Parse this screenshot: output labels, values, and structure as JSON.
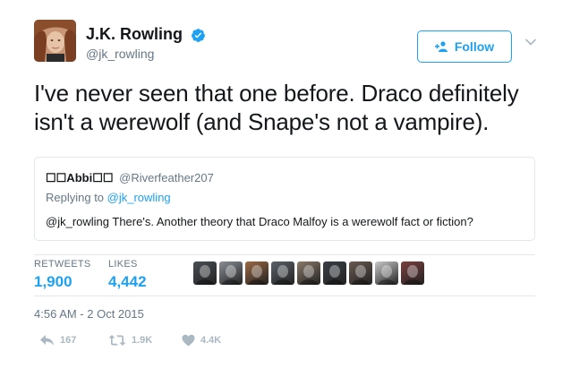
{
  "author": {
    "name": "J.K. Rowling",
    "handle": "@jk_rowling",
    "verified": true,
    "verified_icon": "verified-badge-icon"
  },
  "follow_button": {
    "label": "Follow",
    "icon": "add-user-icon"
  },
  "menu_icon": "chevron-down-icon",
  "tweet": {
    "text": "I've never seen that one before. Draco definitely isn't a werewolf (and Snape's not a vampire)."
  },
  "quoted_tweet": {
    "name": "☐☐Abbi☐☐",
    "handle": "@Riverfeather207",
    "replying_prefix": "Replying to ",
    "replying_to": "@jk_rowling",
    "text": "@jk_rowling There's. Another theory that Draco Malfoy is a werewolf fact or fiction?"
  },
  "stats": {
    "retweets_label": "RETWEETS",
    "retweets_value": "1,900",
    "likes_label": "LIKES",
    "likes_value": "4,442"
  },
  "liker_avatars": [
    {
      "name": "liker-avatar-1",
      "color": "#4a4f55"
    },
    {
      "name": "liker-avatar-2",
      "color": "#8a8f96"
    },
    {
      "name": "liker-avatar-3",
      "color": "#9c6a45"
    },
    {
      "name": "liker-avatar-4",
      "color": "#5b6168"
    },
    {
      "name": "liker-avatar-5",
      "color": "#8a7a6a"
    },
    {
      "name": "liker-avatar-6",
      "color": "#3a3f45"
    },
    {
      "name": "liker-avatar-7",
      "color": "#6b5a52"
    },
    {
      "name": "liker-avatar-8",
      "color": "#c9c9c9"
    },
    {
      "name": "liker-avatar-9",
      "color": "#7b4040"
    }
  ],
  "timestamp": "4:56 AM - 2 Oct 2015",
  "actions": {
    "reply_count": "167",
    "retweet_count": "1.9K",
    "like_count": "4.4K"
  },
  "colors": {
    "accent": "#1da1f2",
    "text": "#14171a",
    "muted": "#657786",
    "border": "#e1e8ed",
    "action_gray": "#aab8c2"
  }
}
